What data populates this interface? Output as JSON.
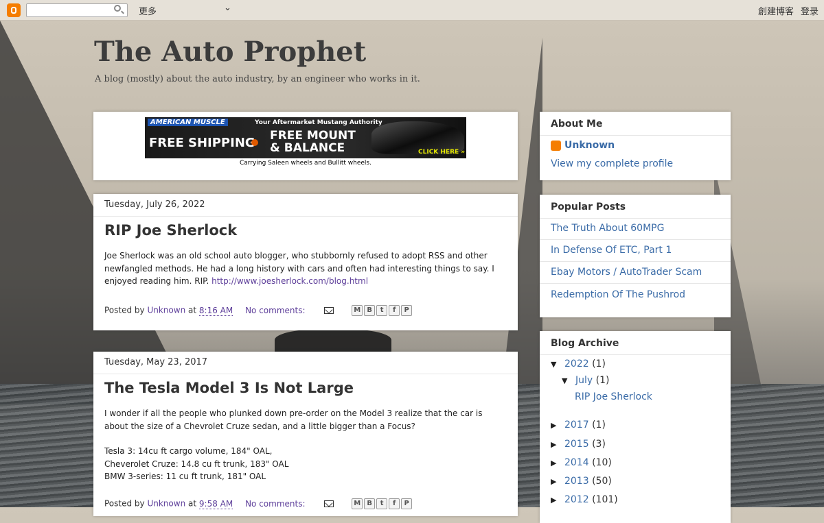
{
  "navbar": {
    "more_label": "更多",
    "create_blog": "創建博客",
    "login": "登录"
  },
  "blog": {
    "title": "The Auto Prophet",
    "description": "A blog (mostly) about the auto industry, by an engineer who works in it."
  },
  "ad": {
    "brand": "AMERICAN MUSCLE",
    "tagline": "Your Aftermarket Mustang Authority",
    "free_shipping": "FREE SHIPPING",
    "free_mount": "FREE MOUNT & BALANCE",
    "click_here": "CLICK HERE »",
    "caption": "Carrying Saleen wheels and Bullitt wheels."
  },
  "posts": [
    {
      "date": "Tuesday, July 26, 2022",
      "title": "RIP Joe Sherlock",
      "body_text": "Joe Sherlock was an old school auto blogger, who stubbornly refused to adopt RSS and other newfangled methods.  He had a long history with cars and often had interesting things to say.  I enjoyed reading him.  RIP. ",
      "body_link": "http://www.joesherlock.com/blog.html",
      "posted_by_label": "Posted by",
      "author": "Unknown",
      "at_label": "at",
      "time": "8:16 AM",
      "comments": "No comments:"
    },
    {
      "date": "Tuesday, May 23, 2017",
      "title": "The Tesla Model 3 Is Not Large",
      "body_paragraph": "I wonder if all the people who plunked down pre-order on the Model 3 realize that the car is about the size of a Chevrolet Cruze sedan, and a little bigger than a Focus?",
      "body_lines": [
        "Tesla 3: 14cu ft cargo volume, 184\" OAL,",
        "Cheverolet Cruze: 14.8 cu ft trunk, 183\" OAL",
        "BMW 3-series: 11 cu ft trunk, 181\" OAL"
      ],
      "posted_by_label": "Posted by",
      "author": "Unknown",
      "at_label": "at",
      "time": "9:58 AM",
      "comments": "No comments:"
    }
  ],
  "share_icons": [
    "email-icon",
    "blogger-icon",
    "twitter-icon",
    "facebook-icon",
    "pinterest-icon"
  ],
  "sidebar": {
    "about": {
      "title": "About Me",
      "name": "Unknown",
      "profile_link": "View my complete profile"
    },
    "popular": {
      "title": "Popular Posts",
      "items": [
        "The Truth About 60MPG",
        "In Defense Of ETC, Part 1",
        "Ebay Motors / AutoTrader Scam",
        "Redemption Of The Pushrod"
      ]
    },
    "archive": {
      "title": "Blog Archive",
      "years": [
        {
          "year": "2022",
          "count": "(1)",
          "expanded": true
        },
        {
          "year": "2017",
          "count": "(1)",
          "expanded": false
        },
        {
          "year": "2015",
          "count": "(3)",
          "expanded": false
        },
        {
          "year": "2014",
          "count": "(10)",
          "expanded": false
        },
        {
          "year": "2013",
          "count": "(50)",
          "expanded": false
        },
        {
          "year": "2012",
          "count": "(101)",
          "expanded": false
        }
      ],
      "month": {
        "name": "July",
        "count": "(1)"
      },
      "month_post": "RIP Joe Sherlock"
    }
  }
}
